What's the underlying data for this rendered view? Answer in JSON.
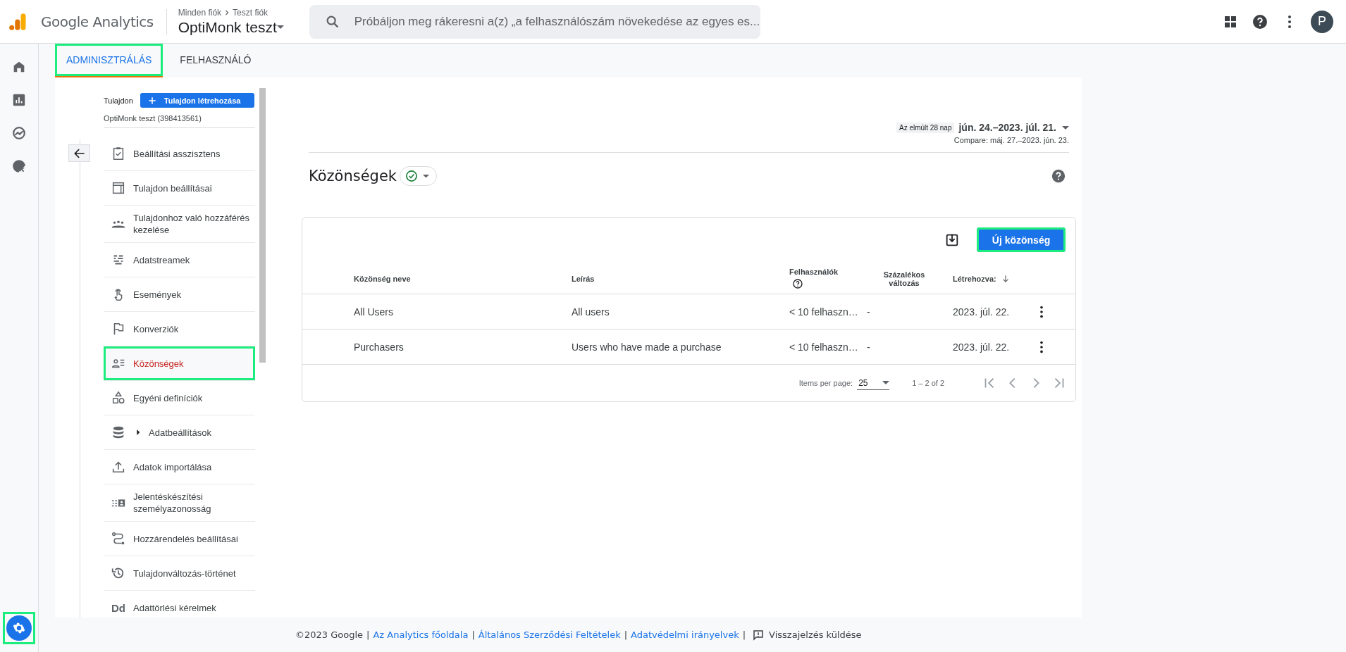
{
  "app": {
    "name": "Google Analytics"
  },
  "account": {
    "breadcrumb": [
      "Minden fiók",
      "Teszt fiók"
    ],
    "property": "OptiMonk teszt"
  },
  "search": {
    "placeholder": "Próbáljon meg rákeresni a(z) „a felhasználószám növekedése az egyes es..."
  },
  "avatar": {
    "initial": "P"
  },
  "rail": [
    {
      "kind": "home",
      "selected": false,
      "highlighted": false
    },
    {
      "kind": "reports",
      "selected": false,
      "highlighted": false
    },
    {
      "kind": "explore",
      "selected": false,
      "highlighted": false
    },
    {
      "kind": "advertising",
      "selected": false,
      "highlighted": false
    },
    {
      "kind": "admin",
      "selected": true,
      "highlighted": true
    }
  ],
  "tabs": [
    {
      "label": "ADMINISZTRÁLÁS",
      "selected": true,
      "highlighted": true
    },
    {
      "label": "FELHASZNÁLÓ",
      "selected": false,
      "highlighted": false
    }
  ],
  "admin_nav": {
    "label": "Tulajdon",
    "create_button": "Tulajdon létrehozása",
    "property": "OptiMonk teszt (398413561)",
    "items": [
      {
        "label": "Beállítási asszisztens",
        "selected": false,
        "highlighted": false
      },
      {
        "label": "Tulajdon beállításai",
        "selected": false,
        "highlighted": false
      },
      {
        "label": "Tulajdonhoz való hozzáférés kezelése",
        "selected": false,
        "highlighted": false
      },
      {
        "label": "Adatstreamek",
        "selected": false,
        "highlighted": false
      },
      {
        "label": "Események",
        "selected": false,
        "highlighted": false
      },
      {
        "label": "Konverziók",
        "selected": false,
        "highlighted": false
      },
      {
        "label": "Közönségek",
        "selected": true,
        "highlighted": true
      },
      {
        "label": "Egyéni definíciók",
        "selected": false,
        "highlighted": false
      },
      {
        "label": "Adatbeállítások",
        "selected": false,
        "highlighted": false,
        "expanded": false
      },
      {
        "label": "Adatok importálása",
        "selected": false,
        "highlighted": false
      },
      {
        "label": "Jelentéskészítési személyazonosság",
        "selected": false,
        "highlighted": false
      },
      {
        "label": "Hozzárendelés beállításai",
        "selected": false,
        "highlighted": false
      },
      {
        "label": "Tulajdonváltozás-történet",
        "selected": false,
        "highlighted": false
      },
      {
        "icon_text": "Dd",
        "label": "Adattörlési kérelmek",
        "selected": false,
        "highlighted": false
      }
    ]
  },
  "date_range": {
    "preset": "Az elmúlt 28 nap",
    "range": "jún. 24.–2023. júl. 21.",
    "compare": "Compare: máj. 27.–2023. jún. 23."
  },
  "page": {
    "title": "Közönségek"
  },
  "table": {
    "new_button": {
      "label": "Új közönség",
      "highlighted": true
    },
    "columns": [
      {
        "label": "Közönség neve",
        "help": false,
        "sorted": false
      },
      {
        "label": "Leírás",
        "help": false,
        "sorted": false
      },
      {
        "label": "Felhasználók",
        "help": true,
        "sorted": false
      },
      {
        "label": "Százalékos változás",
        "help": false,
        "sorted": false
      },
      {
        "label": "Létrehozva:",
        "help": false,
        "sorted": true
      }
    ],
    "rows": [
      {
        "cells": [
          "All Users",
          "All users",
          "< 10 felhaszn…",
          "-",
          "2023. júl. 22."
        ]
      },
      {
        "cells": [
          "Purchasers",
          "Users who have made a purchase",
          "< 10 felhaszn…",
          "-",
          "2023. júl. 22."
        ]
      }
    ],
    "paginator": {
      "label": "Items per page:",
      "page_size": "25",
      "range": "1 – 2 of 2"
    }
  },
  "footer": [
    {
      "kind": "text",
      "text": "©2023 Google"
    },
    {
      "kind": "sep",
      "text": "|"
    },
    {
      "kind": "link",
      "text": "Az Analytics főoldala"
    },
    {
      "kind": "sep",
      "text": "|"
    },
    {
      "kind": "link",
      "text": "Általános Szerződési Feltételek"
    },
    {
      "kind": "sep",
      "text": "|"
    },
    {
      "kind": "link",
      "text": "Adatvédelmi irányelvek"
    },
    {
      "kind": "sep",
      "text": "|"
    },
    {
      "kind": "feedback",
      "text": "Visszajelzés küldése"
    }
  ]
}
